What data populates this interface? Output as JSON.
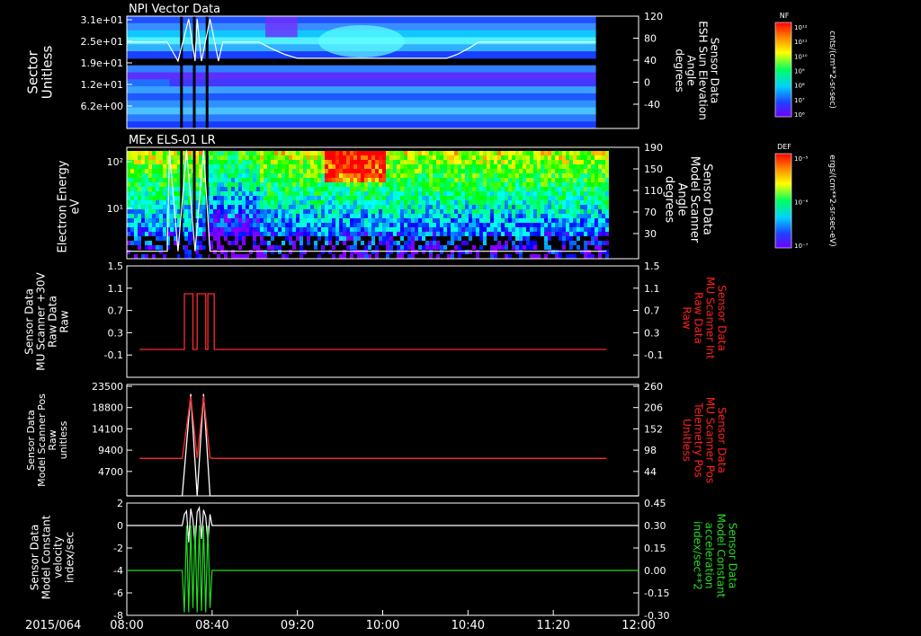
{
  "date_label": "2015/064",
  "time_axis": {
    "ticks": [
      "08:00",
      "08:40",
      "09:20",
      "10:00",
      "10:40",
      "11:20",
      "12:00"
    ]
  },
  "colors": {
    "background": "#000000",
    "axis": "#ffffff",
    "red_trace": "#ff2a2a",
    "green_trace": "#22dd22",
    "right_label_red": "#ff2020",
    "right_label_green": "#22dd22"
  },
  "colorbars": [
    {
      "title": "NF",
      "ticks": [
        "10¹²",
        "10¹¹",
        "10¹⁰",
        "10⁹",
        "10⁸",
        "10⁷",
        "10⁶"
      ],
      "unit": "cnts/(cm**2-sr-sec)"
    },
    {
      "title": "DEF",
      "ticks": [
        "10⁻⁵",
        "10⁻⁶",
        "10⁻⁷"
      ],
      "unit": "ergs/(cm**2-sr-sec-eV)"
    }
  ],
  "chart_data": [
    {
      "type": "heatmap",
      "title": "NPI Vector Data",
      "ylabel": [
        "Sector",
        "Unitless"
      ],
      "yticks": [
        "3.1e+01",
        "2.5e+01",
        "1.9e+01",
        "1.2e+01",
        "6.2e+00"
      ],
      "y2label": [
        "Sensor Data",
        "ESH Sun Elevation",
        "Angle",
        "degrees"
      ],
      "y2ticks": [
        "120",
        "80",
        "40",
        "0",
        "-40"
      ],
      "y2lim": [
        -80,
        120
      ],
      "overlay_line": {
        "x": [
          "08:00",
          "08:19",
          "08:24",
          "08:29",
          "08:32",
          "08:33",
          "08:35",
          "08:39",
          "08:43",
          "08:45",
          "08:47",
          "09:02",
          "09:08",
          "09:14",
          "09:20",
          "09:40",
          "10:00",
          "10:30",
          "10:35",
          "10:40",
          "10:45",
          "11:40"
        ],
        "y": [
          74,
          74,
          40,
          115,
          40,
          115,
          40,
          115,
          40,
          74,
          74,
          74,
          62,
          52,
          45,
          45,
          45,
          45,
          52,
          62,
          74,
          74
        ]
      }
    },
    {
      "type": "heatmap",
      "title": "MEx ELS-01 LR",
      "ylabel": [
        "Electron Energy",
        "eV"
      ],
      "yticks": [
        "10²",
        "10¹"
      ],
      "ylog": true,
      "y2label": [
        "Sensor Data",
        "Model Scanner",
        "Angle",
        "degrees"
      ],
      "y2ticks": [
        "190",
        "150",
        "110",
        "70",
        "30"
      ],
      "y2lim": [
        10,
        190
      ],
      "overlay_line": {
        "x": [
          "08:00",
          "08:19",
          "08:20",
          "08:24",
          "08:28",
          "08:32",
          "08:36",
          "08:39",
          "08:40",
          "11:45"
        ],
        "y": [
          22,
          22,
          185,
          22,
          185,
          22,
          185,
          22,
          22,
          22
        ]
      }
    },
    {
      "type": "line",
      "ylabel": [
        "Sensor Data",
        "MU Scanner +30V",
        "Raw Data",
        "Raw"
      ],
      "yticks": [
        "1.5",
        "1.1",
        "0.7",
        "0.3",
        "-0.1"
      ],
      "ylim": [
        -0.5,
        1.5
      ],
      "y2label": [
        "Sensor Data",
        "MU Scanner Int",
        "Raw Data",
        "Raw"
      ],
      "y2ticks": [
        "1.5",
        "1.1",
        "0.7",
        "0.3",
        "-0.1"
      ],
      "series": [
        {
          "color": "#ff2a2a",
          "x": [
            "08:06",
            "08:26",
            "08:27",
            "08:29",
            "08:31",
            "08:33",
            "08:35",
            "08:37",
            "08:38",
            "08:40",
            "08:41",
            "11:45"
          ],
          "y": [
            0,
            0,
            1,
            1,
            0,
            1,
            1,
            0,
            1,
            1,
            0,
            0
          ]
        }
      ]
    },
    {
      "type": "line",
      "ylabel": [
        "Sensor Data",
        "Model Scanner Pos",
        "Raw",
        "unitless"
      ],
      "yticks": [
        "23500",
        "18800",
        "14100",
        "9400",
        "4700"
      ],
      "ylim": [
        0,
        23500
      ],
      "y2label": [
        "Sensor Data",
        "MU Scanner Pos",
        "Telemetry Pos",
        "Unitless"
      ],
      "y2ticks": [
        "260",
        "206",
        "152",
        "98",
        "44"
      ],
      "y2lim": [
        -10,
        260
      ],
      "series": [
        {
          "name_color": "white",
          "color": "#ffffff",
          "x": [
            "08:00",
            "08:26",
            "08:30",
            "08:33",
            "08:36",
            "08:39",
            "08:40",
            "12:00"
          ],
          "y": [
            0,
            0,
            21500,
            0,
            21500,
            0,
            0,
            0
          ]
        },
        {
          "color": "#ff2a2a",
          "x": [
            "08:06",
            "08:26",
            "08:30",
            "08:33",
            "08:36",
            "08:39",
            "08:41",
            "11:45"
          ],
          "y": [
            7900,
            7900,
            21000,
            8000,
            21000,
            8000,
            7900,
            7900
          ]
        }
      ]
    },
    {
      "type": "line",
      "ylabel": [
        "Sensor Data",
        "Model Constant",
        "velocity",
        "index/sec"
      ],
      "yticks": [
        "2",
        "0",
        "-2",
        "-4",
        "-6",
        "-8"
      ],
      "ylim": [
        -8,
        2
      ],
      "y2label": [
        "Sensor Data",
        "Model Constant",
        "acceleration",
        "index/sec**2"
      ],
      "y2ticks": [
        "0.45",
        "0.30",
        "0.15",
        "0.00",
        "-0.15",
        "-0.30"
      ],
      "y2lim": [
        -0.3,
        0.45
      ],
      "series": [
        {
          "color": "#ffffff",
          "x": [
            "08:00",
            "08:26",
            "08:27",
            "08:28",
            "08:29",
            "08:30",
            "08:31",
            "08:32",
            "08:33",
            "08:34",
            "08:35",
            "08:36",
            "08:37",
            "08:38",
            "08:39",
            "08:40",
            "12:00"
          ],
          "y": [
            0,
            0,
            1,
            1.3,
            -1.5,
            1.5,
            0.5,
            -1.8,
            1.2,
            1.6,
            -1.2,
            1.4,
            0.8,
            -1.5,
            1.0,
            0,
            0
          ]
        },
        {
          "color": "#22dd22",
          "x": [
            "08:00",
            "08:26",
            "08:27",
            "08:28",
            "08:29",
            "08:30",
            "08:31",
            "08:32",
            "08:33",
            "08:34",
            "08:35",
            "08:36",
            "08:37",
            "08:38",
            "08:39",
            "08:40",
            "12:00"
          ],
          "y": [
            0.0,
            0.0,
            -0.28,
            0.3,
            -0.28,
            0.3,
            -0.25,
            0.3,
            -0.28,
            0.3,
            -0.27,
            0.3,
            -0.28,
            0.3,
            -0.25,
            0.0,
            0.0
          ]
        }
      ]
    }
  ]
}
